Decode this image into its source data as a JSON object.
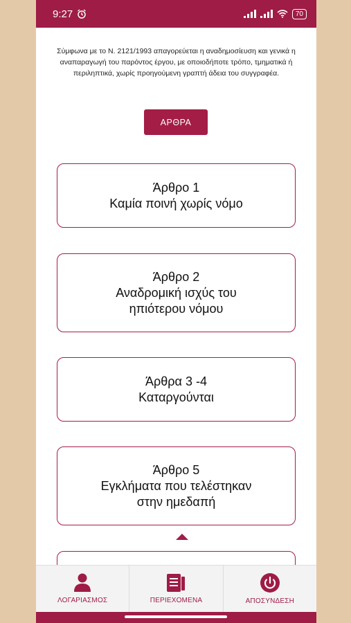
{
  "status_bar": {
    "time": "9:27",
    "battery": "70"
  },
  "copyright": "Σύμφωνα με το Ν. 2121/1993 απαγορεύεται η αναδημοσίευση και γενικά η αναπαραγωγή του παρόντος έργου, με οποιοδήποτε τρόπο, τμηματικά ή περιληπτικά, χωρίς προηγούμενη γραπτή άδεια του συγγραφέα.",
  "arthra_button": "ΑΡΘΡΑ",
  "articles": [
    {
      "text": "Άρθρο 1\nΚαμία ποινή χωρίς νόμο"
    },
    {
      "text": "Άρθρο 2\nΑναδρομική ισχύς του\nηπιότερου νόμου"
    },
    {
      "text": "Άρθρα 3 -4\nΚαταργούνται"
    },
    {
      "text": "Άρθρο 5\nΕγκλήματα που τελέστηκαν\nστην ημεδαπή"
    },
    {
      "text": ""
    }
  ],
  "bottom_nav": {
    "account": "ΛΟΓΑΡΙΑΣΜΟΣ",
    "contents": "ΠΕΡΙΕΧΟΜΕΝΑ",
    "logout": "ΑΠΟΣΥΝΔΕΣΗ"
  },
  "colors": {
    "accent": "#a31d46",
    "page_bg": "#e3c9a8"
  },
  "icons": {
    "account": "user-icon",
    "contents": "document-list-icon",
    "logout": "power-icon"
  }
}
